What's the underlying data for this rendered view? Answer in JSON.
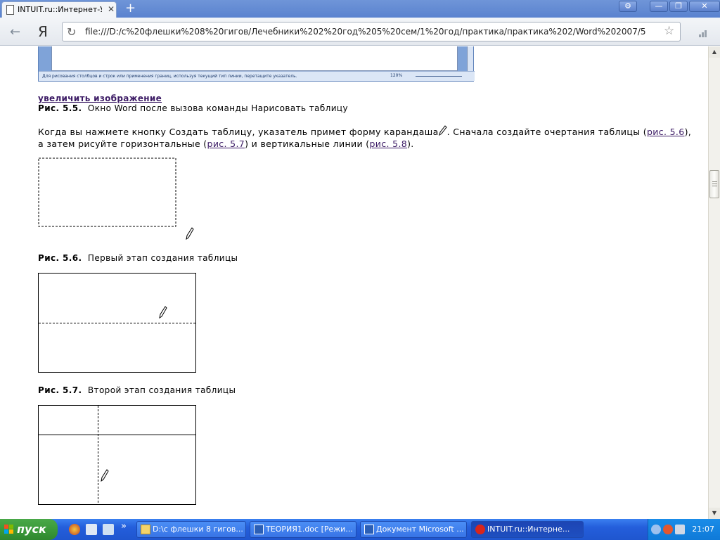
{
  "browser": {
    "tab_title": "INTUIT.ru::Интернет-Ун",
    "tab_close": "✕",
    "new_tab": "+",
    "window_buttons": [
      "⚙",
      "—",
      "❐",
      "✕"
    ],
    "yandex_logo": "Я",
    "address": "file:///D:/с%20флешки%208%20гигов/Лечебники%202%20год%205%20сем/1%20год/практика/практика%202/Word%202007/5"
  },
  "page": {
    "word_status_text": "Для рисования столбцов и строк или применения границ, используя текущий тип линии, перетащите указатель.",
    "word_zoom": "120%",
    "enlarge_link": "увеличить изображение",
    "fig55_label": "Рис. 5.5.",
    "fig55_caption": "Окно Word после вызова команды Нарисовать таблицу",
    "para_part1": "Когда вы нажмете кнопку Создать таблицу, указатель примет форму карандаша",
    "para_part2": ". Сначала создайте очертания таблицы (",
    "ref56": "рис. 5.6",
    "para_part3": "), а затем рисуйте горизонтальные (",
    "ref57": "рис. 5.7",
    "para_part4": ") и вертикальные линии (",
    "ref58": "рис. 5.8",
    "para_part5": ").",
    "fig56_label": "Рис. 5.6.",
    "fig56_caption": "Первый этап создания таблицы",
    "fig57_label": "Рис. 5.7.",
    "fig57_caption": "Второй этап создания таблицы"
  },
  "taskbar": {
    "start_label": "пуск",
    "tasks": [
      "D:\\с флешки 8 гигов...",
      "ТЕОРИЯ1.doc [Режи...",
      "Документ Microsoft ...",
      "INTUIT.ru::Интерне..."
    ],
    "overflow": "»",
    "clock": "21:07"
  },
  "colors": {
    "link": "#3b1a64",
    "taskbar": "#245edb",
    "start": "#3b9a3a"
  }
}
